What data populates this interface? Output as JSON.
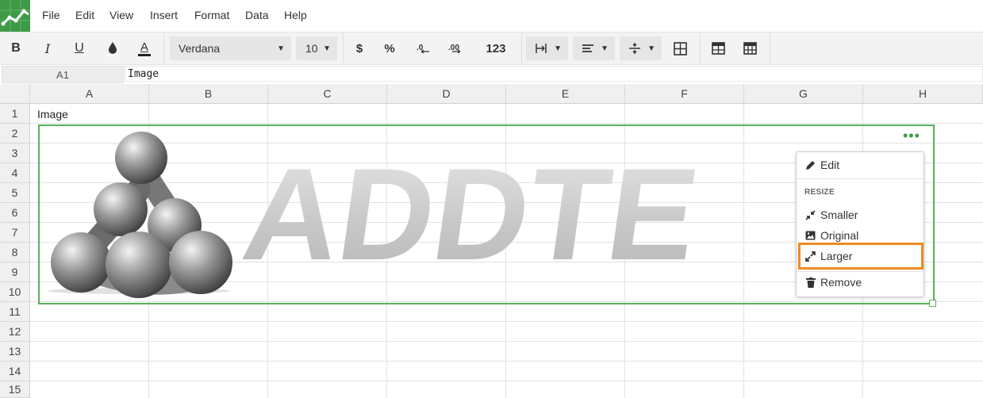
{
  "menubar": {
    "items": [
      "File",
      "Edit",
      "View",
      "Insert",
      "Format",
      "Data",
      "Help"
    ]
  },
  "toolbar": {
    "bold": "B",
    "italic": "I",
    "underline": "U",
    "text_color": "A",
    "font_family": "Verdana",
    "font_size": "10",
    "currency": "$",
    "percent": "%",
    "number_format": "123"
  },
  "formula_bar": {
    "cell_ref": "A1",
    "value": "Image"
  },
  "grid": {
    "columns": [
      "A",
      "B",
      "C",
      "D",
      "E",
      "F",
      "G",
      "H"
    ],
    "rows": [
      "1",
      "2",
      "3",
      "4",
      "5",
      "6",
      "7",
      "8",
      "9",
      "10",
      "11",
      "12",
      "13",
      "14",
      "15"
    ],
    "cells": {
      "A1": "Image"
    }
  },
  "image": {
    "logo_text": "ADDTE",
    "menu_trigger": "•••"
  },
  "context_menu": {
    "edit": "Edit",
    "resize_header": "RESIZE",
    "smaller": "Smaller",
    "original": "Original",
    "larger": "Larger",
    "remove": "Remove"
  },
  "colors": {
    "accent": "#3f9a48",
    "highlight": "#f08a24",
    "selection": "#58b058"
  }
}
